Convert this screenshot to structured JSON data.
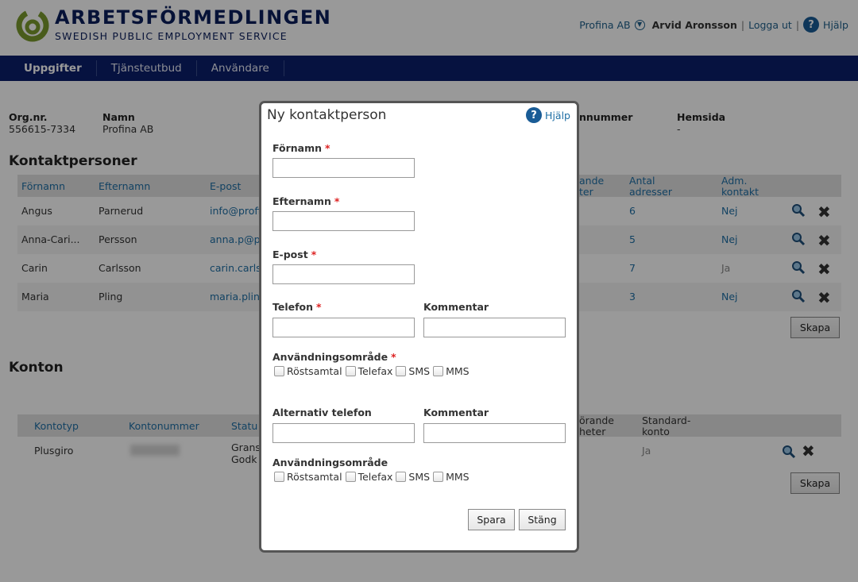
{
  "brand": {
    "title": "ARBETSFÖRMEDLINGEN",
    "subtitle": "SWEDISH PUBLIC EMPLOYMENT SERVICE"
  },
  "topbar": {
    "company": "Profina AB",
    "user": "Arvid Aronsson",
    "sep1": "|",
    "logout": "Logga ut",
    "sep2": "|",
    "help": "Hjälp",
    "help_glyph": "?"
  },
  "nav": {
    "items": [
      {
        "label": "Uppgifter",
        "active": true
      },
      {
        "label": "Tjänsteutbud",
        "active": false
      },
      {
        "label": "Användare",
        "active": false
      }
    ]
  },
  "org": {
    "orgnr_label": "Org.nr.",
    "orgnr_value": "556615-7334",
    "name_label": "Namn",
    "name_value": "Profina AB",
    "phone_label": "nnummer",
    "web_label": "Hemsida",
    "web_value": "-"
  },
  "contacts": {
    "title": "Kontaktpersoner",
    "headers": {
      "first": "Förnamn",
      "last": "Efternamn",
      "email": "E-post",
      "units": "ande\nter",
      "count": "Antal\nadresser",
      "adm": "Adm.\nkontakt"
    },
    "rows": [
      {
        "first": "Angus",
        "last": "Parnerud",
        "email": "info@profi",
        "count": "6",
        "adm": "Nej"
      },
      {
        "first": "Anna-Cari...",
        "last": "Persson",
        "email": "anna.p@p",
        "count": "5",
        "adm": "Nej"
      },
      {
        "first": "Carin",
        "last": "Carlsson",
        "email": "carin.carls",
        "count": "7",
        "adm": "Ja"
      },
      {
        "first": "Maria",
        "last": "Pling",
        "email": "maria.plin",
        "count": "3",
        "adm": "Nej"
      }
    ],
    "create_label": "Skapa"
  },
  "accounts": {
    "title": "Konton",
    "headers": {
      "type": "Kontotyp",
      "number": "Kontonummer",
      "status": "Statu",
      "units": "örande\nheter",
      "standard": "Standard-\nkonto"
    },
    "rows": [
      {
        "type": "Plusgiro",
        "status_line1": "Grans",
        "status_line2": "Godk",
        "standard": "Ja"
      }
    ],
    "create_label": "Skapa"
  },
  "modal": {
    "title": "Ny kontaktperson",
    "help": "Hjälp",
    "help_glyph": "?",
    "required_mark": "*",
    "fields": {
      "first_name": "Förnamn",
      "last_name": "Efternamn",
      "email": "E-post",
      "phone": "Telefon",
      "comment1": "Kommentar",
      "usage1": "Användningsområde",
      "alt_phone": "Alternativ telefon",
      "comment2": "Kommentar",
      "usage2": "Användningsområde"
    },
    "checkbox_options": [
      "Röstsamtal",
      "Telefax",
      "SMS",
      "MMS"
    ],
    "save": "Spara",
    "close": "Stäng"
  },
  "colors": {
    "navy": "#0b1e6b",
    "brand_navy": "#0b1e5c",
    "link_blue": "#1f6fa5",
    "logo_green": "#7a9a2e",
    "required_red": "#dd2222"
  }
}
